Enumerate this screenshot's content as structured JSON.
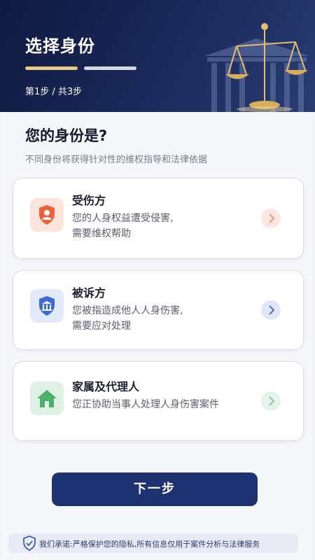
{
  "header": {
    "title": "选择身份",
    "step_text": "第1步 / 共3步",
    "progress": {
      "current": 1,
      "total": 3
    }
  },
  "question": {
    "title": "您的身份是?",
    "subtitle": "不同身份将获得针对性的维权指导和法律依据"
  },
  "cards": [
    {
      "title": "受伤方",
      "desc_line1": "您的人身权益遭受侵害,",
      "desc_line2": "需要维权帮助",
      "icon": "user-shield-icon",
      "accent": "#e8623a"
    },
    {
      "title": "被诉方",
      "desc_line1": "您被指造成他人人身伤害,",
      "desc_line2": "需要应对处理",
      "icon": "courthouse-shield-icon",
      "accent": "#3c6bd6"
    },
    {
      "title": "家属及代理人",
      "desc_line1": "您正协助当事人处理人身伤害案件",
      "desc_line2": "",
      "icon": "house-icon",
      "accent": "#4caf6a"
    }
  ],
  "next_button": "下一步",
  "privacy_note": "我们承诺:严格保护您的隐私,所有信息仅用于案件分析与法律服务",
  "colors": {
    "header_bg": "#15214b",
    "primary": "#1e3170",
    "progress_active": "#e9c98a"
  }
}
